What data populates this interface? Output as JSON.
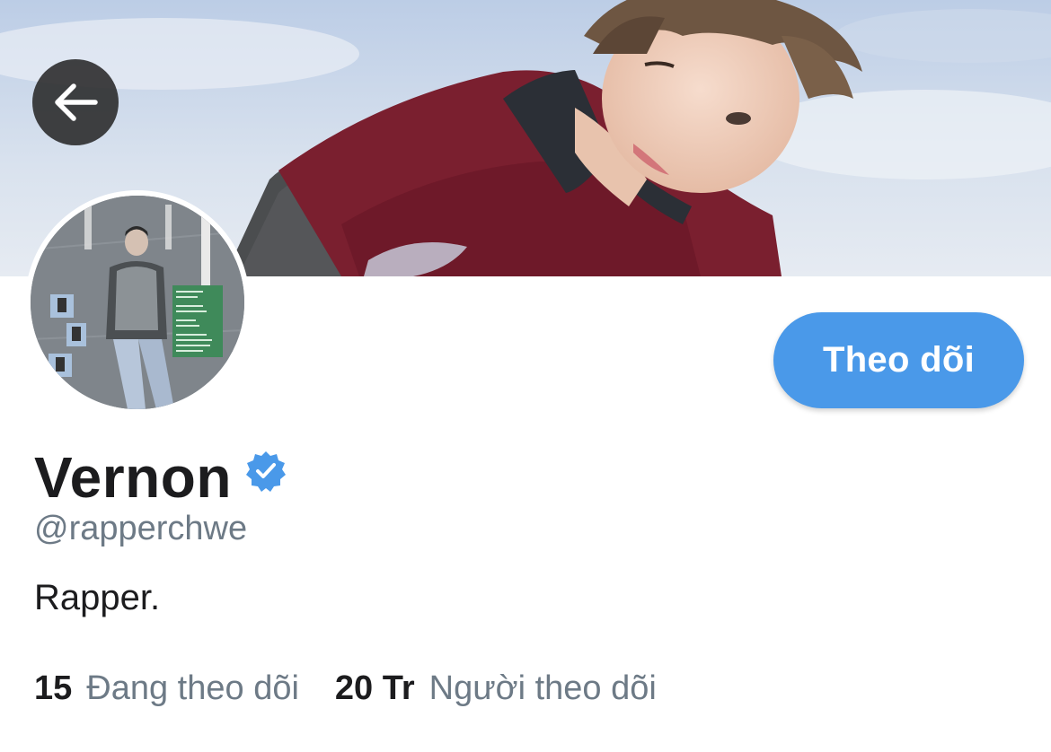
{
  "header": {
    "back_icon": "arrow-left-icon"
  },
  "profile": {
    "display_name": "Vernon",
    "verified_icon": "verified-badge-icon",
    "handle": "@rapperchwe",
    "bio": "Rapper.",
    "follow_button_label": "Theo dõi",
    "stats": {
      "following_count": "15",
      "following_label": "Đang theo dõi",
      "followers_count": "20 Tr",
      "followers_label": "Người theo dõi"
    }
  },
  "colors": {
    "accent": "#4a99e9",
    "text_primary": "#1c1c1e",
    "text_secondary": "#6d7a86",
    "back_button_bg": "#282828"
  }
}
